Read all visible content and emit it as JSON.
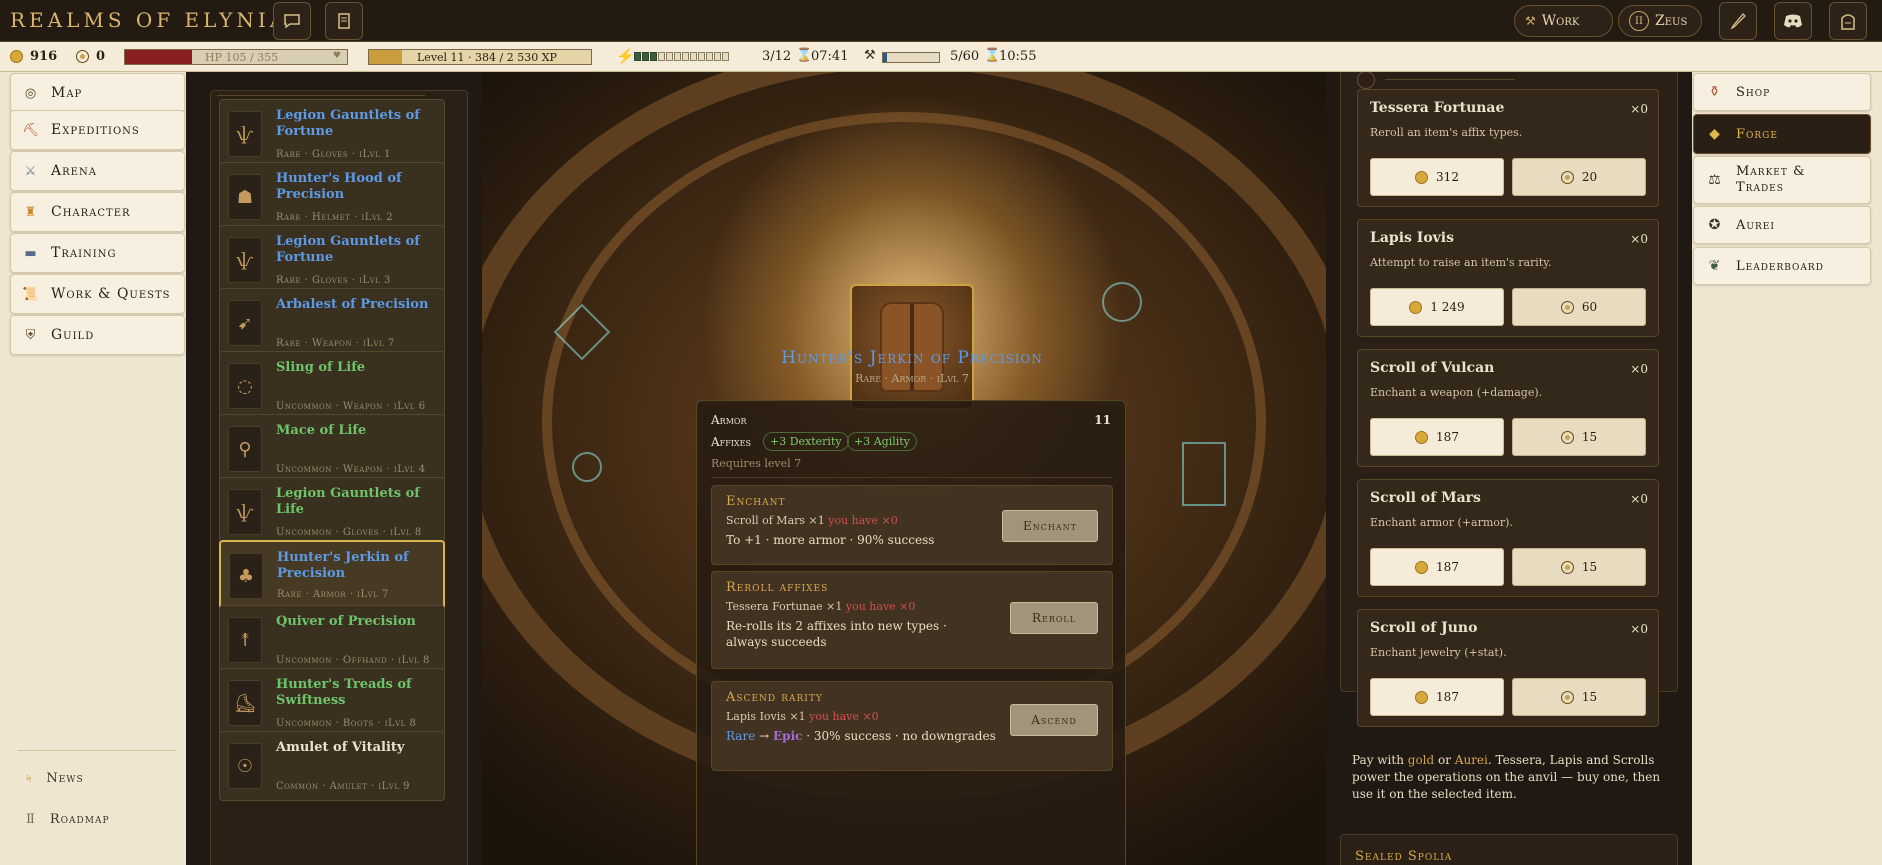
{
  "app": {
    "title": "REALMS OF ELYNIA"
  },
  "header": {
    "work_label": "Work",
    "user_label": "Zeus",
    "user_badge": "II"
  },
  "status": {
    "gold": "916",
    "aurei": "0",
    "hp_text": "HP 105 / 355",
    "hp_fraction": 0.3,
    "xp_text": "Level 11 · 384 / 2 530 XP",
    "xp_fraction": 0.15,
    "energy_text": "3/12",
    "energy_segments_total": 12,
    "energy_segments_filled": 3,
    "energy_timer": "07:41",
    "work_text": "5/60",
    "work_fraction": 0.08,
    "work_timer": "10:55"
  },
  "left_nav": {
    "items": [
      {
        "label": "Map",
        "icon": "compass-icon"
      },
      {
        "label": "Expeditions",
        "icon": "pickaxe-icon"
      },
      {
        "label": "Arena",
        "icon": "crossed-swords-icon"
      },
      {
        "label": "Character",
        "icon": "helmet-icon"
      },
      {
        "label": "Training",
        "icon": "anvil-icon"
      },
      {
        "label": "Work & Quests",
        "icon": "scroll-icon"
      },
      {
        "label": "Guild",
        "icon": "shield-icon"
      }
    ],
    "news_label": "News",
    "roadmap_label": "Roadmap"
  },
  "inventory": {
    "items": [
      {
        "name": "Legion Gauntlets of Fortune",
        "meta": "Rare · Gloves · iLvl 1",
        "rarity": "rare",
        "icon": "gauntlets-icon"
      },
      {
        "name": "Hunter's Hood of Precision",
        "meta": "Rare · Helmet · iLvl 2",
        "rarity": "rare",
        "icon": "hood-icon"
      },
      {
        "name": "Legion Gauntlets of Fortune",
        "meta": "Rare · Gloves · iLvl 3",
        "rarity": "rare",
        "icon": "gauntlets-icon"
      },
      {
        "name": "Arbalest of Precision",
        "meta": "Rare · Weapon · iLvl 7",
        "rarity": "rare",
        "icon": "crossbow-icon"
      },
      {
        "name": "Sling of Life",
        "meta": "Uncommon · Weapon · iLvl 6",
        "rarity": "uncommon",
        "icon": "sling-icon"
      },
      {
        "name": "Mace of Life",
        "meta": "Uncommon · Weapon · iLvl 4",
        "rarity": "uncommon",
        "icon": "mace-icon"
      },
      {
        "name": "Legion Gauntlets of Life",
        "meta": "Uncommon · Gloves · iLvl 8",
        "rarity": "uncommon",
        "icon": "gauntlets-icon"
      },
      {
        "name": "Hunter's Jerkin of Precision",
        "meta": "Rare · Armor · iLvl 7",
        "rarity": "rare",
        "icon": "jerkin-icon",
        "selected": true
      },
      {
        "name": "Quiver of Precision",
        "meta": "Uncommon · Offhand · iLvl 8",
        "rarity": "uncommon",
        "icon": "quiver-icon"
      },
      {
        "name": "Hunter's Treads of Swiftness",
        "meta": "Uncommon · Boots · iLvl 8",
        "rarity": "uncommon",
        "icon": "boots-icon"
      },
      {
        "name": "Amulet of Vitality",
        "meta": "Common · Amulet · iLvl 9",
        "rarity": "common",
        "icon": "amulet-icon"
      }
    ]
  },
  "anvil": {
    "item_name": "Hunter's Jerkin of Precision",
    "item_meta": "Rare · Armor · iLvl 7",
    "armor_label": "Armor",
    "armor_value": "11",
    "affixes_label": "Affixes",
    "affixes": [
      "+3 Dexterity",
      "+3 Agility"
    ],
    "requires": "Requires level 7",
    "operations": [
      {
        "title": "Enchant",
        "line1": "Scroll of Mars ×1 ",
        "have": "you have ×0",
        "line2": "To +1 · more armor · 90% success",
        "button": "Enchant"
      },
      {
        "title": "Reroll affixes",
        "line1": "Tessera Fortunae ×1 ",
        "have": "you have ×0",
        "line2": "Re-rolls its 2 affixes into new types · always succeeds",
        "button": "Reroll"
      },
      {
        "title": "Ascend rarity",
        "line1": "Lapis Iovis ×1 ",
        "have": "you have ×0",
        "line2_from": "Rare",
        "line2_arrow": "→",
        "line2_to": "Epic",
        "line2_rest": " · 30% success · no downgrades",
        "button": "Ascend"
      }
    ]
  },
  "shop": {
    "cards": [
      {
        "name": "Tessera Fortunae",
        "qty": "×0",
        "desc": "Reroll an item's affix types.",
        "gold_price": "312",
        "aurei_price": "20"
      },
      {
        "name": "Lapis Iovis",
        "qty": "×0",
        "desc": "Attempt to raise an item's rarity.",
        "gold_price": "1 249",
        "aurei_price": "60"
      },
      {
        "name": "Scroll of Vulcan",
        "qty": "×0",
        "desc": "Enchant a weapon (+damage).",
        "gold_price": "187",
        "aurei_price": "15"
      },
      {
        "name": "Scroll of Mars",
        "qty": "×0",
        "desc": "Enchant armor (+armor).",
        "gold_price": "187",
        "aurei_price": "15"
      },
      {
        "name": "Scroll of Juno",
        "qty": "×0",
        "desc": "Enchant jewelry (+stat).",
        "gold_price": "187",
        "aurei_price": "15"
      }
    ],
    "note_pre": "Pay with ",
    "note_gold": "gold",
    "note_mid": " or ",
    "note_aurei": "Aurei",
    "note_post": ". Tessera, Lapis and Scrolls power the operations on the anvil — buy one, then use it on the selected item.",
    "sealed_title": "Sealed Spolia"
  },
  "right_nav": {
    "items": [
      {
        "label": "Shop",
        "icon": "urn-icon"
      },
      {
        "label": "Forge",
        "icon": "gem-icon",
        "active": true
      },
      {
        "label": "Market & Trades",
        "icon": "scales-icon"
      },
      {
        "label": "Aurei",
        "icon": "star-coin-icon"
      },
      {
        "label": "Leaderboard",
        "icon": "laurel-icon"
      }
    ]
  },
  "colors": {
    "rare": "#5d9ae6",
    "uncommon": "#6ec46a",
    "common": "#ece2cc",
    "epic": "#a86ad8",
    "accent_gold": "#d8a84a",
    "hp": "#8a1f1f"
  }
}
